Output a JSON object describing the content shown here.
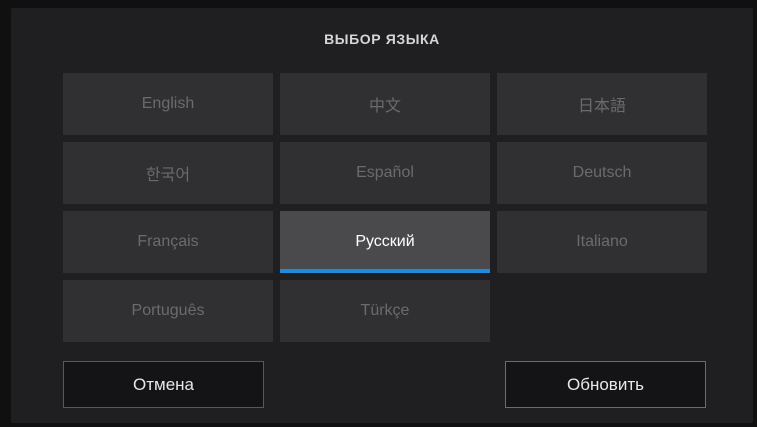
{
  "dialog": {
    "title": "ВЫБОР ЯЗЫКА",
    "languages": [
      {
        "label": "English",
        "selected": false
      },
      {
        "label": "中文",
        "selected": false
      },
      {
        "label": "日本語",
        "selected": false
      },
      {
        "label": "한국어",
        "selected": false
      },
      {
        "label": "Español",
        "selected": false
      },
      {
        "label": "Deutsch",
        "selected": false
      },
      {
        "label": "Français",
        "selected": false
      },
      {
        "label": "Русский",
        "selected": true
      },
      {
        "label": "Italiano",
        "selected": false
      },
      {
        "label": "Português",
        "selected": false
      },
      {
        "label": "Türkçe",
        "selected": false
      }
    ],
    "cancel_label": "Отмена",
    "update_label": "Обновить"
  },
  "colors": {
    "accent": "#1f8be0",
    "background": "#1f1f21",
    "tile": "#303032",
    "tile_selected": "#4a4a4d"
  }
}
